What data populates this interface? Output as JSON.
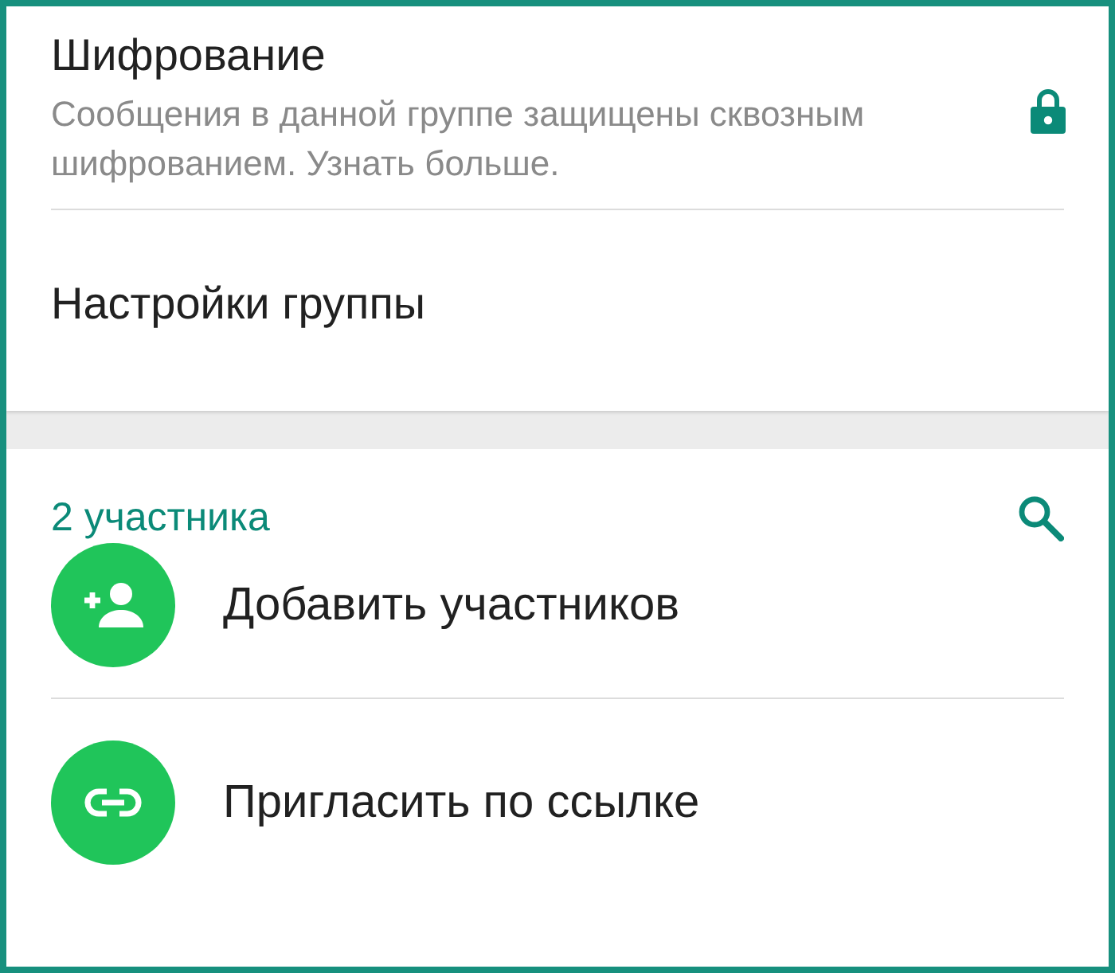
{
  "encryption": {
    "title": "Шифрование",
    "description": "Сообщения в данной группе защищены сквозным шифрованием. Узнать больше."
  },
  "group_settings": {
    "label": "Настройки группы"
  },
  "participants": {
    "count_label": "2 участника",
    "actions": [
      {
        "kind": "add",
        "label": "Добавить участников"
      },
      {
        "kind": "link",
        "label": "Пригласить по ссылке"
      }
    ]
  }
}
